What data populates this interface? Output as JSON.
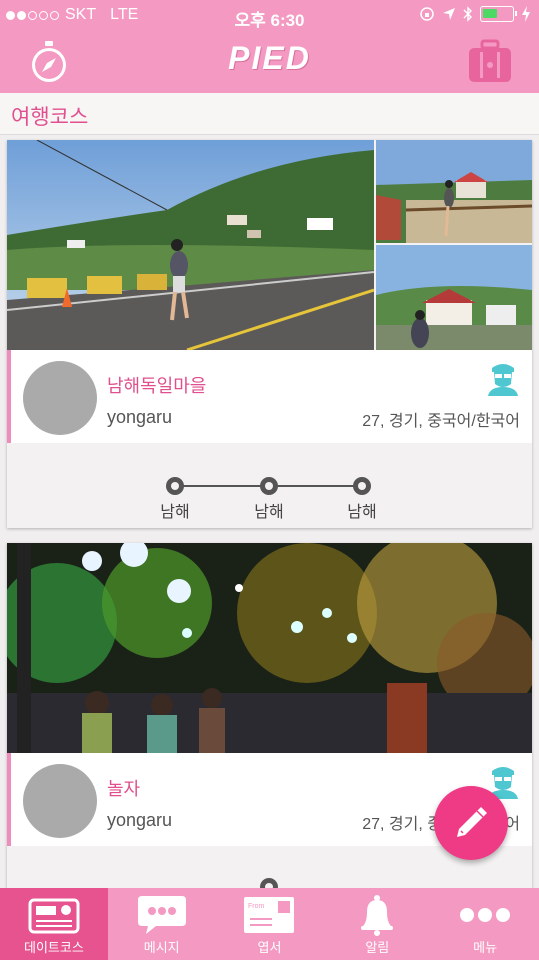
{
  "status": {
    "carrier": "SKT",
    "network": "LTE",
    "time": "오후 6:30"
  },
  "app": {
    "logo": "PIED"
  },
  "section": {
    "title": "여행코스"
  },
  "cards": [
    {
      "place": "남해독일마을",
      "user": "yongaru",
      "meta": "27, 경기, 중국어/한국어",
      "stops": [
        "남해",
        "남해",
        "남해"
      ]
    },
    {
      "place": "놀자",
      "user": "yongaru",
      "meta": "27, 경기, 중국어/한국어"
    }
  ],
  "tabs": [
    {
      "label": "데이트코스",
      "icon": "radio-icon"
    },
    {
      "label": "메시지",
      "icon": "chat-icon"
    },
    {
      "label": "엽서",
      "icon": "postcard-icon"
    },
    {
      "label": "알림",
      "icon": "bell-icon"
    },
    {
      "label": "메뉴",
      "icon": "more-icon"
    }
  ],
  "colors": {
    "brand": "#f49ac2",
    "accent": "#e0508f",
    "fab": "#ef3b86"
  }
}
